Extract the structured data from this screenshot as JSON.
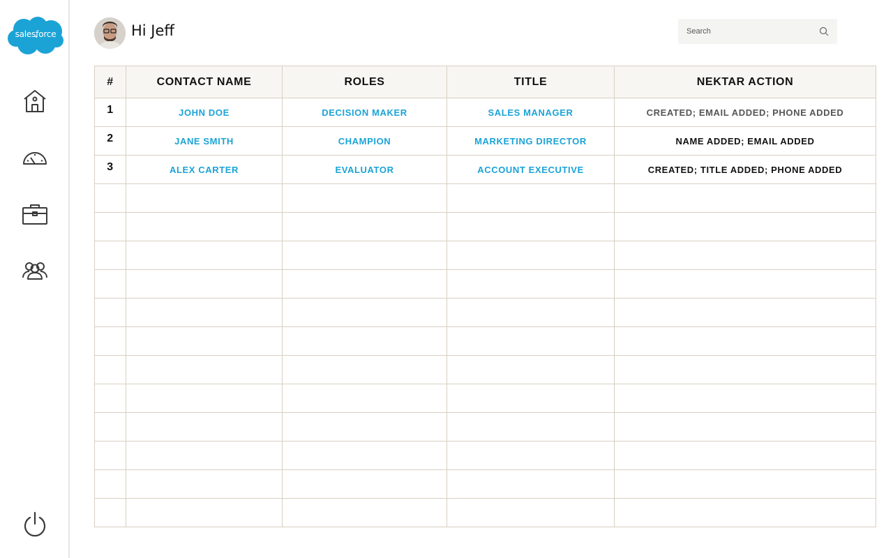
{
  "brand": {
    "logo_text": "salesforce",
    "logo_color": "#1ba3d6"
  },
  "nav": {
    "items": [
      {
        "name": "home",
        "icon": "home-icon"
      },
      {
        "name": "dashboard",
        "icon": "speedometer-icon"
      },
      {
        "name": "opportunities",
        "icon": "briefcase-icon"
      },
      {
        "name": "contacts",
        "icon": "users-icon"
      }
    ],
    "logout_icon": "power-icon"
  },
  "header": {
    "greeting": "Hi Jeff",
    "search": {
      "placeholder": "Search",
      "value": ""
    }
  },
  "table": {
    "columns": [
      "#",
      "CONTACT NAME",
      "ROLES",
      "TITLE",
      "NEKTAR ACTION"
    ],
    "rows": [
      {
        "num": "1",
        "name": "JOHN DOE",
        "role": "DECISION MAKER",
        "title": "SALES MANAGER",
        "action": "CREATED; EMAIL ADDED; PHONE ADDED"
      },
      {
        "num": "2",
        "name": "JANE SMITH",
        "role": "CHAMPION",
        "title": "MARKETING DIRECTOR",
        "action": "NAME ADDED; EMAIL ADDED"
      },
      {
        "num": "3",
        "name": "ALEX CARTER",
        "role": "EVALUATOR",
        "title": "ACCOUNT EXECUTIVE",
        "action": "CREATED; TITLE ADDED; PHONE ADDED"
      }
    ],
    "empty_rows": 12
  },
  "colors": {
    "link": "#1ba3d6",
    "border": "#d8cfc2",
    "header_bg": "#f8f6f2"
  }
}
